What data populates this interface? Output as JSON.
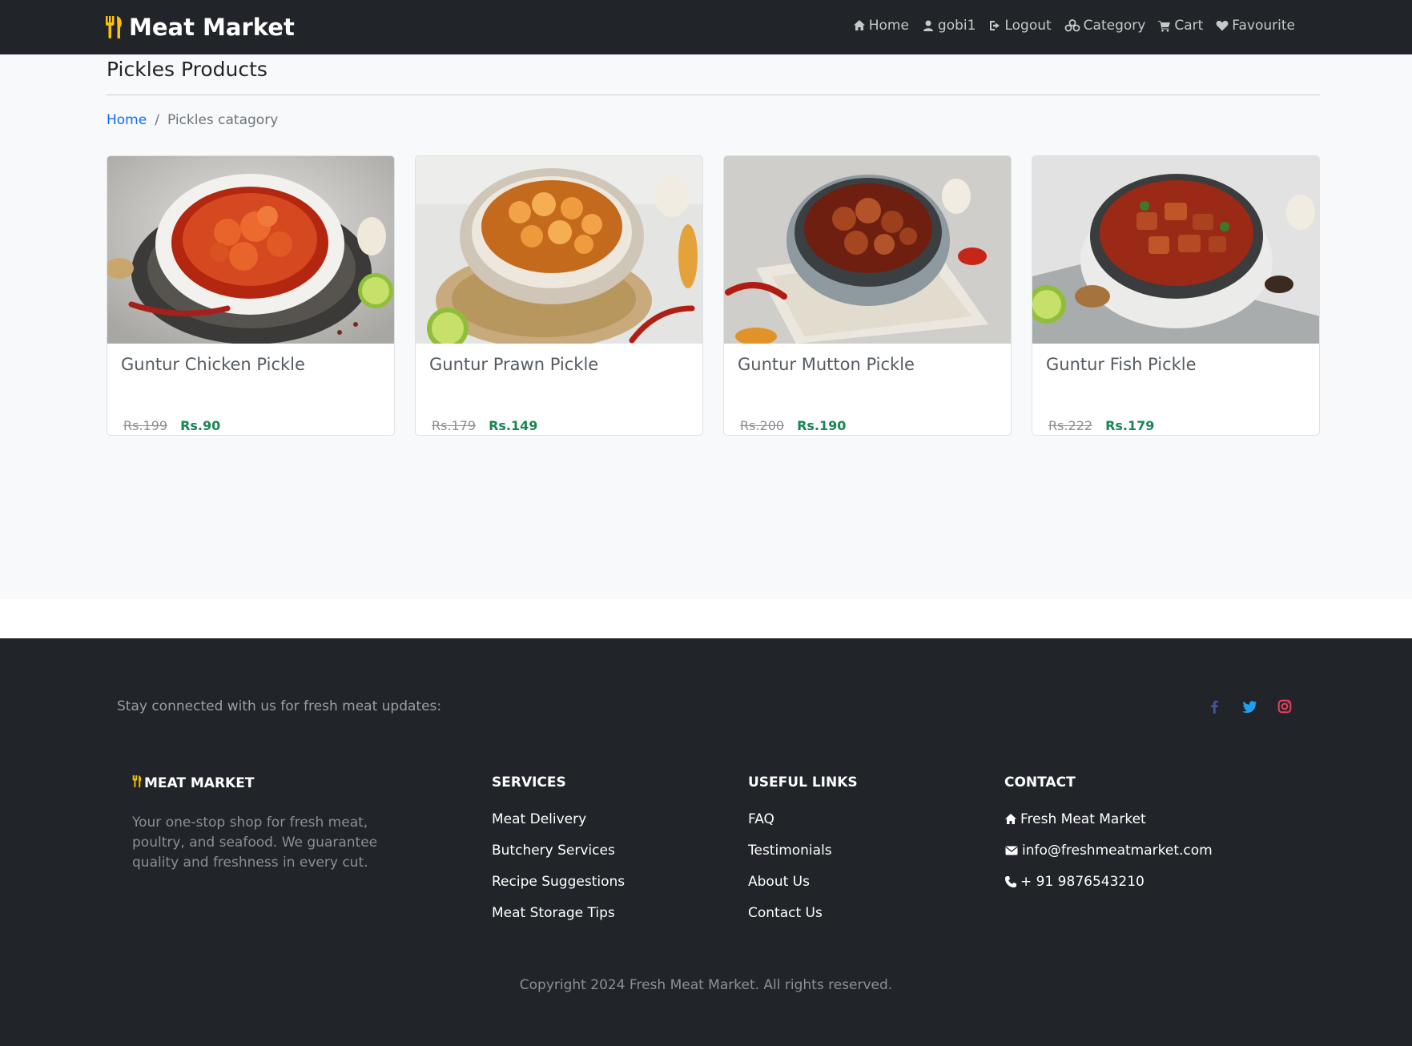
{
  "navbar": {
    "brand": "Meat Market",
    "links": [
      {
        "label": "Home",
        "icon": "home-icon"
      },
      {
        "label": "gobi1",
        "icon": "user-icon"
      },
      {
        "label": "Logout",
        "icon": "logout-icon"
      },
      {
        "label": "Category",
        "icon": "cubes-icon"
      },
      {
        "label": "Cart",
        "icon": "cart-icon"
      },
      {
        "label": "Favourite",
        "icon": "heart-icon"
      }
    ]
  },
  "main": {
    "title": "Pickles Products",
    "breadcrumb": {
      "home": "Home",
      "separator": "/",
      "current": "Pickles catagory"
    },
    "products": [
      {
        "name": "Guntur Chicken Pickle",
        "old_price": "Rs.199",
        "new_price": "Rs.90"
      },
      {
        "name": "Guntur Prawn Pickle",
        "old_price": "Rs.179",
        "new_price": "Rs.149"
      },
      {
        "name": "Guntur Mutton Pickle",
        "old_price": "Rs.200",
        "new_price": "Rs.190"
      },
      {
        "name": "Guntur Fish Pickle",
        "old_price": "Rs.222",
        "new_price": "Rs.179"
      }
    ]
  },
  "footer": {
    "stay_connected": "Stay connected with us for fresh meat updates:",
    "social": [
      {
        "icon": "facebook-icon",
        "color": "#3b5998"
      },
      {
        "icon": "twitter-icon",
        "color": "#1da1f2"
      },
      {
        "icon": "instagram-icon",
        "color": "#e4405f"
      }
    ],
    "brand": {
      "heading": "MEAT MARKET",
      "description": "Your one-stop shop for fresh meat, poultry, and seafood. We guarantee quality and freshness in every cut."
    },
    "services": {
      "heading": "SERVICES",
      "links": [
        "Meat Delivery",
        "Butchery Services",
        "Recipe Suggestions",
        "Meat Storage Tips"
      ]
    },
    "useful_links": {
      "heading": "USEFUL LINKS",
      "links": [
        "FAQ",
        "Testimonials",
        "About Us",
        "Contact Us"
      ]
    },
    "contact": {
      "heading": "CONTACT",
      "address": "Fresh Meat Market",
      "email": "info@freshmeatmarket.com",
      "phone": "+ 91 9876543210"
    },
    "copyright": "Copyright 2024 Fresh Meat Market. All rights reserved."
  },
  "colors": {
    "dark": "#212529",
    "accent_yellow": "#ffc107",
    "link_blue": "#0d6efd",
    "price_green": "#198754"
  }
}
